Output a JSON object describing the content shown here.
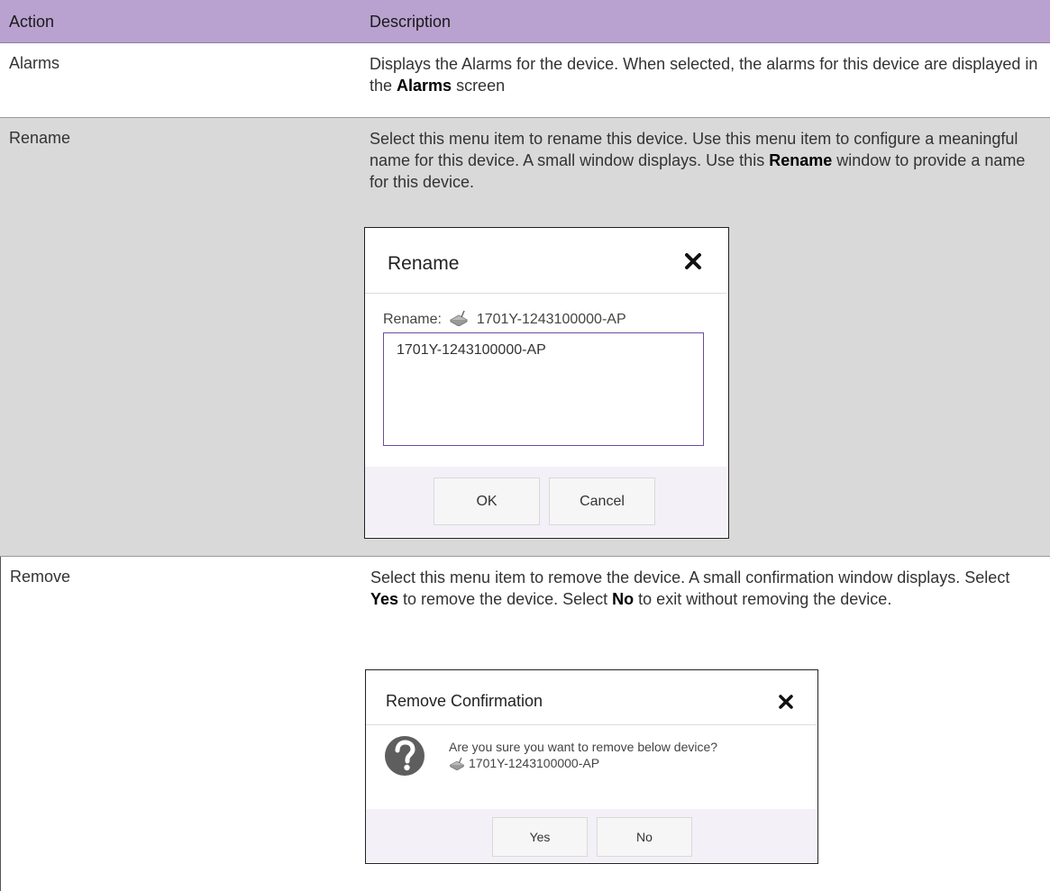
{
  "header": {
    "action": "Action",
    "description": "Description"
  },
  "rows": [
    {
      "action": "Alarms",
      "desc_parts": [
        "Displays the Alarms for the device. When selected, the alarms for this device are displayed in the ",
        "Alarms",
        " screen"
      ]
    },
    {
      "action": "Rename",
      "desc_parts": [
        "Select this menu item to rename this device. Use this menu item to configure a meaningful name for this device. A small window displays. Use this ",
        "Rename",
        " window to provide a name for this device."
      ],
      "dialog": {
        "title": "Rename",
        "label": "Rename:",
        "device": "1701Y-1243100000-AP",
        "input_value": "1701Y-1243100000-AP",
        "ok": "OK",
        "cancel": "Cancel"
      }
    },
    {
      "action": "Remove",
      "desc_parts": [
        "Select this menu item to remove the device. A small confirmation window displays. Select ",
        "Yes",
        " to remove the device. Select ",
        "No",
        " to exit without removing the device."
      ],
      "dialog": {
        "title": "Remove Confirmation",
        "question": "Are you sure you want to remove below device?",
        "device": "1701Y-1243100000-AP",
        "yes": "Yes",
        "no": "No"
      }
    }
  ],
  "icons": {
    "close": "close-x-icon",
    "device": "access-point-device-icon",
    "question": "question-mark-icon"
  },
  "colors": {
    "header_bg": "#b9a2cf",
    "shaded_row": "#d9d9d9",
    "dialog_footer": "#f3f0f8",
    "input_border": "#6a4e9a"
  }
}
